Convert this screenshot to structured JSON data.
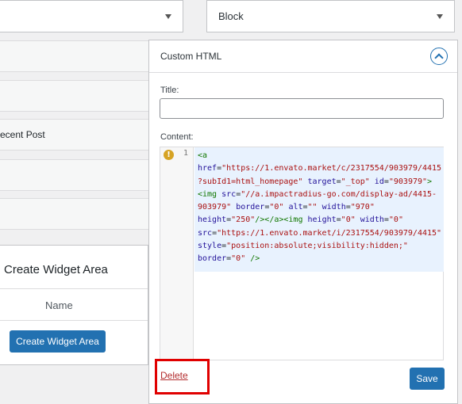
{
  "selects": {
    "left_value": "",
    "right_value": "Block"
  },
  "left_list": {
    "recent_post_label": "ecent Post"
  },
  "widget": {
    "title": "Custom HTML",
    "title_label": "Title:",
    "title_value": "",
    "content_label": "Content:",
    "line_number": "1",
    "warning_glyph": "!",
    "code": {
      "l1": "<a",
      "l2_attr1": "href",
      "l2_val1": "\"https://1.envato.market/c/2317554/903979/4415",
      "l3_val1": "?subId1=html_homepage\"",
      "l3_attr2": "target",
      "l3_val2": "\"_top\"",
      "l3_attr3": "id",
      "l3_val3": "\"903979\"",
      "l3_close": ">",
      "l4_tag": "<img",
      "l4_attr1": "src",
      "l4_val1": "\"//a.impactradius-go.com/display-ad/4415-",
      "l5_val1": "903979\"",
      "l5_attr2": "border",
      "l5_val2": "\"0\"",
      "l5_attr3": "alt",
      "l5_val3": "\"\"",
      "l5_attr4": "width",
      "l5_val4": "\"970\"",
      "l6_attr1": "height",
      "l6_val1": "\"250\"",
      "l6_tags": "/></a><img",
      "l6_attr2": "height",
      "l6_val2": "\"0\"",
      "l6_attr3": "width",
      "l6_val3": "\"0\"",
      "l7_attr1": "src",
      "l7_val1": "\"https://1.envato.market/i/2317554/903979/4415\"",
      "l8_attr1": "style",
      "l8_val1": "\"position:absolute;visibility:hidden;\"",
      "l9_attr1": "border",
      "l9_val1": "\"0\"",
      "l9_close": "/>"
    },
    "delete_label": "Delete",
    "save_label": "Save"
  },
  "create_widget_area": {
    "title": "Create Widget Area",
    "name_header": "Name",
    "button_label": "Create Widget Area"
  },
  "colors": {
    "primary": "#2271b1",
    "delete": "#b32d2e",
    "highlight": "#e00000",
    "code_bg": "#e8f2fe"
  }
}
